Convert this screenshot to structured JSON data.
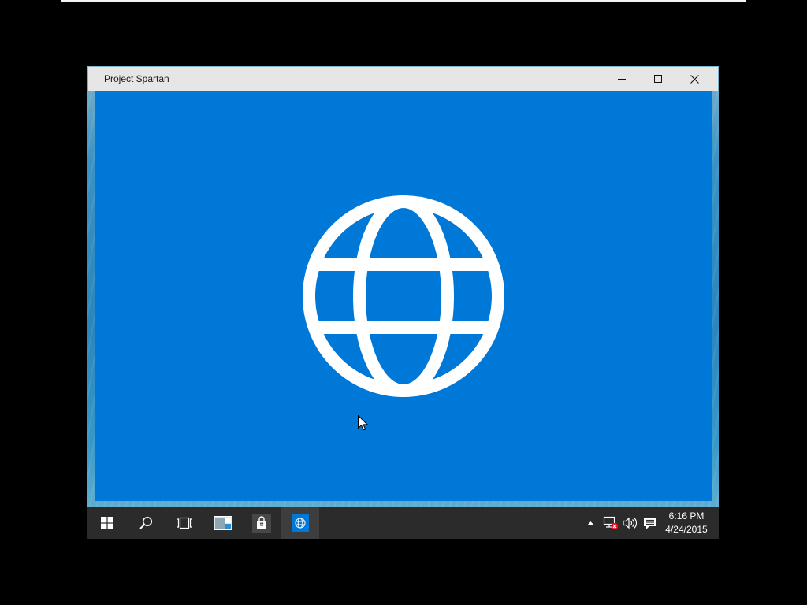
{
  "window": {
    "title": "Project Spartan",
    "title_bar_icons": [
      "minimize-icon",
      "maximize-icon",
      "close-icon"
    ],
    "splash_icon": "globe-icon"
  },
  "taskbar": {
    "items": [
      {
        "icon": "windows-logo-icon",
        "active": false
      },
      {
        "icon": "search-icon",
        "active": false
      },
      {
        "icon": "task-view-icon",
        "active": false
      },
      {
        "icon": "app-window-icon",
        "active": false
      },
      {
        "icon": "store-icon",
        "active": false
      },
      {
        "icon": "spartan-globe-icon",
        "active": true
      }
    ],
    "tray_icons": [
      "chevron-up-icon",
      "network-disconnected-icon",
      "volume-icon",
      "action-center-icon"
    ],
    "clock": {
      "time": "6:16 PM",
      "date": "4/24/2015"
    }
  },
  "colors": {
    "accent": "#0078d7",
    "title_bar": "#e6e6e6",
    "taskbar": "#2b2b2b",
    "active_item": "#3d3d3d",
    "network_error": "#e81123"
  }
}
